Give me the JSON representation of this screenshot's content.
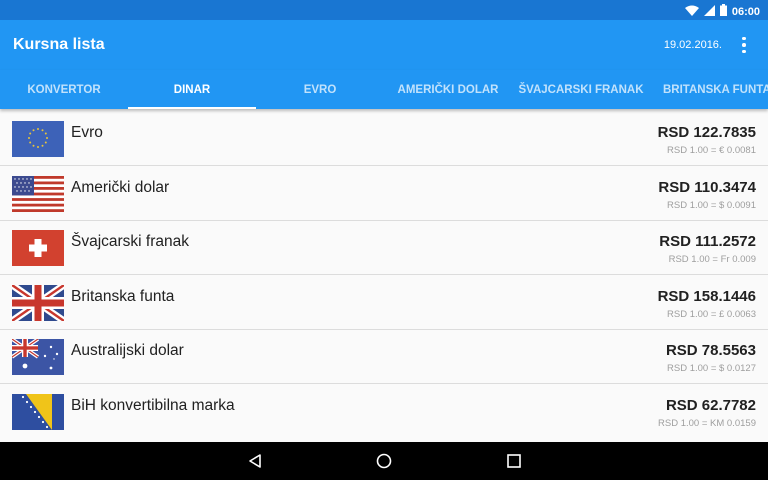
{
  "status_bar": {
    "time": "06:00",
    "icons": [
      "wifi-icon",
      "signal-icon",
      "battery-icon"
    ]
  },
  "app_bar": {
    "title": "Kursna lista",
    "date": "19.02.2016.",
    "menu_icon": "more-vert-icon"
  },
  "tabs": [
    {
      "label": "KONVERTOR"
    },
    {
      "label": "DINAR",
      "active": true
    },
    {
      "label": "EVRO"
    },
    {
      "label": "AMERIČKI DOLAR"
    },
    {
      "label": "ŠVAJCARSKI FRANAK"
    },
    {
      "label": "BRITANSKA FUNTA"
    }
  ],
  "rates": [
    {
      "name": "Evro",
      "rate": "RSD 122.7835",
      "conversion": "RSD 1.00 = € 0.0081",
      "flag": "eu-flag-icon"
    },
    {
      "name": "Američki dolar",
      "rate": "RSD 110.3474",
      "conversion": "RSD 1.00 = $ 0.0091",
      "flag": "us-flag-icon"
    },
    {
      "name": "Švajcarski franak",
      "rate": "RSD 111.2572",
      "conversion": "RSD 1.00 = Fr 0.009",
      "flag": "ch-flag-icon"
    },
    {
      "name": "Britanska funta",
      "rate": "RSD 158.1446",
      "conversion": "RSD 1.00 = £ 0.0063",
      "flag": "uk-flag-icon"
    },
    {
      "name": "Australijski dolar",
      "rate": "RSD 78.5563",
      "conversion": "RSD 1.00 = $ 0.0127",
      "flag": "au-flag-icon"
    },
    {
      "name": "BiH konvertibilna marka",
      "rate": "RSD 62.7782",
      "conversion": "RSD 1.00 = KM 0.0159",
      "flag": "ba-flag-icon"
    }
  ],
  "nav_bar": {
    "buttons": [
      "back-icon",
      "home-icon",
      "recents-icon"
    ]
  },
  "colors": {
    "primary": "#2196f3",
    "primary_dark": "#1976d2",
    "text": "#212121",
    "secondary_text": "#9e9e9e"
  }
}
